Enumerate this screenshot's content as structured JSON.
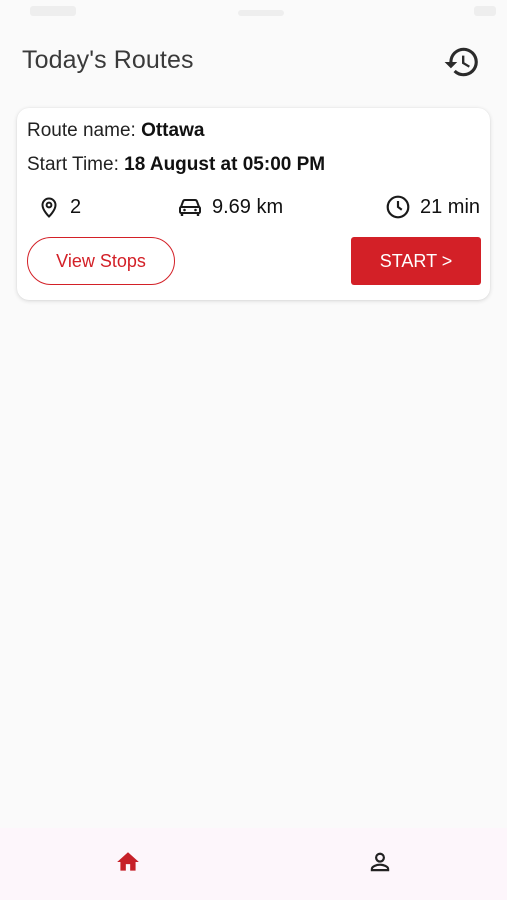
{
  "header": {
    "title": "Today's Routes",
    "history_icon": "history-icon"
  },
  "route": {
    "name_label": "Route name: ",
    "name": "Ottawa",
    "start_label": "Start Time: ",
    "start_time": "18 August at 05:00 PM",
    "stops_count": "2",
    "distance": "9.69 km",
    "duration": "21 min",
    "icons": {
      "stops": "location-pin-icon",
      "distance": "car-icon",
      "duration": "clock-icon"
    },
    "view_stops_label": "View Stops",
    "start_label_button": "START >"
  },
  "bottom_nav": {
    "items": [
      {
        "name": "home",
        "icon": "home-icon",
        "active": true
      },
      {
        "name": "profile",
        "icon": "person-icon",
        "active": false
      }
    ]
  },
  "colors": {
    "accent": "#d32027",
    "background": "#fafafa",
    "nav_background": "#fdf6fb"
  }
}
